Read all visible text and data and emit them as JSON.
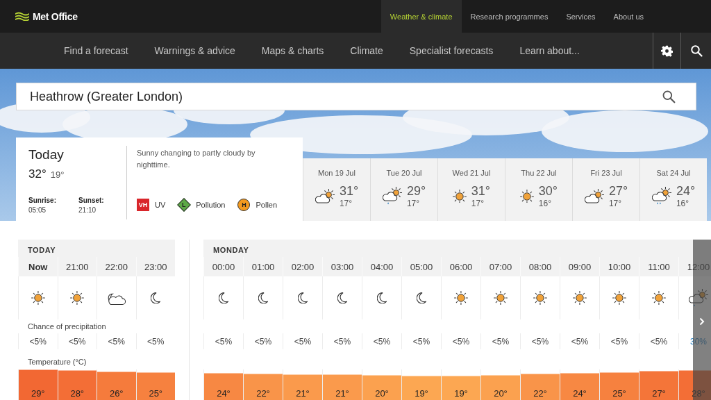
{
  "brand": {
    "name": "Met Office"
  },
  "top_nav": [
    {
      "label": "Weather & climate",
      "selected": true
    },
    {
      "label": "Research programmes",
      "selected": false
    },
    {
      "label": "Services",
      "selected": false
    },
    {
      "label": "About us",
      "selected": false
    }
  ],
  "main_nav": [
    "Find a forecast",
    "Warnings & advice",
    "Maps & charts",
    "Climate",
    "Specialist forecasts",
    "Learn about..."
  ],
  "search": {
    "value": "Heathrow (Greater London)"
  },
  "today": {
    "title": "Today",
    "high": "32°",
    "low": "19°",
    "sunrise_label": "Sunrise:",
    "sunrise": "05:05",
    "sunset_label": "Sunset:",
    "sunset": "21:10",
    "summary": "Sunny changing to partly cloudy by nighttime.",
    "indicators": [
      {
        "kind": "uv",
        "code": "VH",
        "label": "UV",
        "color": "#d9262b"
      },
      {
        "kind": "pollution",
        "code": "L",
        "label": "Pollution",
        "color": "#5ca846"
      },
      {
        "kind": "pollen",
        "code": "H",
        "label": "Pollen",
        "color": "#f49a1f"
      }
    ]
  },
  "days": [
    {
      "date": "Mon 19 Jul",
      "kind": "partly-cloudy",
      "high": "31°",
      "low": "17°"
    },
    {
      "date": "Tue 20 Jul",
      "kind": "light-shower",
      "high": "29°",
      "low": "17°"
    },
    {
      "date": "Wed 21 Jul",
      "kind": "sunny",
      "high": "31°",
      "low": "17°"
    },
    {
      "date": "Thu 22 Jul",
      "kind": "sunny",
      "high": "30°",
      "low": "16°"
    },
    {
      "date": "Fri 23 Jul",
      "kind": "partly-cloudy",
      "high": "27°",
      "low": "17°"
    },
    {
      "date": "Sat 24 Jul",
      "kind": "heavy-shower",
      "high": "24°",
      "low": "16°"
    }
  ],
  "hourly": {
    "precip_label": "Chance of precipitation",
    "temp_label": "Temperature (°C)",
    "groups": [
      {
        "day": "TODAY",
        "hours": [
          {
            "time": "Now",
            "current": true,
            "kind": "sunny",
            "precip": "<5%",
            "rain_likely": false,
            "temp": "29°"
          },
          {
            "time": "21:00",
            "current": false,
            "kind": "sunny",
            "precip": "<5%",
            "rain_likely": false,
            "temp": "28°"
          },
          {
            "time": "22:00",
            "current": false,
            "kind": "partly-cloudy-night",
            "precip": "<5%",
            "rain_likely": false,
            "temp": "26°"
          },
          {
            "time": "23:00",
            "current": false,
            "kind": "clear-night",
            "precip": "<5%",
            "rain_likely": false,
            "temp": "25°"
          }
        ]
      },
      {
        "day": "MONDAY",
        "hours": [
          {
            "time": "00:00",
            "current": false,
            "kind": "clear-night",
            "precip": "<5%",
            "rain_likely": false,
            "temp": "24°"
          },
          {
            "time": "01:00",
            "current": false,
            "kind": "clear-night",
            "precip": "<5%",
            "rain_likely": false,
            "temp": "22°"
          },
          {
            "time": "02:00",
            "current": false,
            "kind": "clear-night",
            "precip": "<5%",
            "rain_likely": false,
            "temp": "21°"
          },
          {
            "time": "03:00",
            "current": false,
            "kind": "clear-night",
            "precip": "<5%",
            "rain_likely": false,
            "temp": "21°"
          },
          {
            "time": "04:00",
            "current": false,
            "kind": "clear-night",
            "precip": "<5%",
            "rain_likely": false,
            "temp": "20°"
          },
          {
            "time": "05:00",
            "current": false,
            "kind": "clear-night",
            "precip": "<5%",
            "rain_likely": false,
            "temp": "19°"
          },
          {
            "time": "06:00",
            "current": false,
            "kind": "sunny",
            "precip": "<5%",
            "rain_likely": false,
            "temp": "19°"
          },
          {
            "time": "07:00",
            "current": false,
            "kind": "sunny",
            "precip": "<5%",
            "rain_likely": false,
            "temp": "20°"
          },
          {
            "time": "08:00",
            "current": false,
            "kind": "sunny",
            "precip": "<5%",
            "rain_likely": false,
            "temp": "22°"
          },
          {
            "time": "09:00",
            "current": false,
            "kind": "sunny",
            "precip": "<5%",
            "rain_likely": false,
            "temp": "24°"
          },
          {
            "time": "10:00",
            "current": false,
            "kind": "sunny",
            "precip": "<5%",
            "rain_likely": false,
            "temp": "25°"
          },
          {
            "time": "11:00",
            "current": false,
            "kind": "sunny",
            "precip": "<5%",
            "rain_likely": false,
            "temp": "27°"
          },
          {
            "time": "12:00",
            "current": false,
            "kind": "light-shower",
            "precip": "30%",
            "rain_likely": true,
            "temp": "28°"
          }
        ]
      }
    ]
  }
}
